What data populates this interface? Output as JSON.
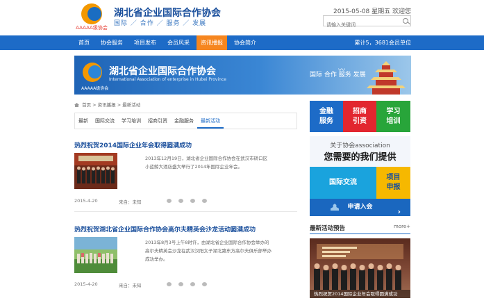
{
  "header": {
    "logo_text": "AAAAA级协会",
    "title": "湖北省企业国际合作协会",
    "slogan": "国际 ／ 合作 ／ 服务 ／ 发展",
    "date_line": "2015-05-08 星期五 欢迎您",
    "search_placeholder": "请输入关键词"
  },
  "nav": {
    "items": [
      "首页",
      "协会服务",
      "项目发布",
      "会员风采",
      "资讯播报",
      "协会简介"
    ],
    "active_index": 4,
    "stats": "累计5，3681会员单位"
  },
  "banner": {
    "title": "湖北省企业国际合作协会",
    "english": "International Association of enterprise in Hubei Province",
    "grade": "AAAAA级协会",
    "slogan": "国际 合作 服务 发展"
  },
  "breadcrumb": "首页 > 资讯播报 > 最新活动",
  "tabs": {
    "items": [
      "最新",
      "国际交流",
      "学习培训",
      "招商引资",
      "金融服务",
      "最新活动"
    ],
    "active_index": 5
  },
  "articles": [
    {
      "title": "热烈祝贺2014国际企业年会取得圆满成功",
      "summary": "2013年12月19日，湖北省企业国际合作协会在武汉市硚口区小蓝鲸大酒店盛大举行了2014年国际企业年会。",
      "date": "2015-4-20",
      "source": "来自：未知"
    },
    {
      "title": "热烈祝贺湖北省企业国际合作协会高尔夫精英会沙龙活动圆满成功",
      "summary": "2013年8月3号上午8时许，由湖北省企业国际合作协会举办的高尔夫精英会沙龙在武汉汉阳太子湖北路东方高尔夫俱乐部举办成功举办。",
      "date": "2015-4-20",
      "source": "来自：未知"
    }
  ],
  "sidebar": {
    "tiles": {
      "finance": "金融\n服务",
      "investment": "招商\n引资",
      "training": "学习\n培训",
      "exchange": "国际交流",
      "project": "项目\n申报"
    },
    "banner_line1": "关于协会association",
    "banner_line2": "您需要的我们提供",
    "join": "申请入会",
    "activity_head": "最新活动预告",
    "more": "more+",
    "photo_caption": "热烈祝贺2014国际企业年会取得圆满成功"
  },
  "colors": {
    "brand_blue": "#1d6bc7",
    "accent_orange": "#f6861f",
    "tile_red": "#e2262f",
    "tile_green": "#28a53a",
    "tile_yellow": "#f6b800",
    "tile_cyan": "#1aa3dd"
  }
}
